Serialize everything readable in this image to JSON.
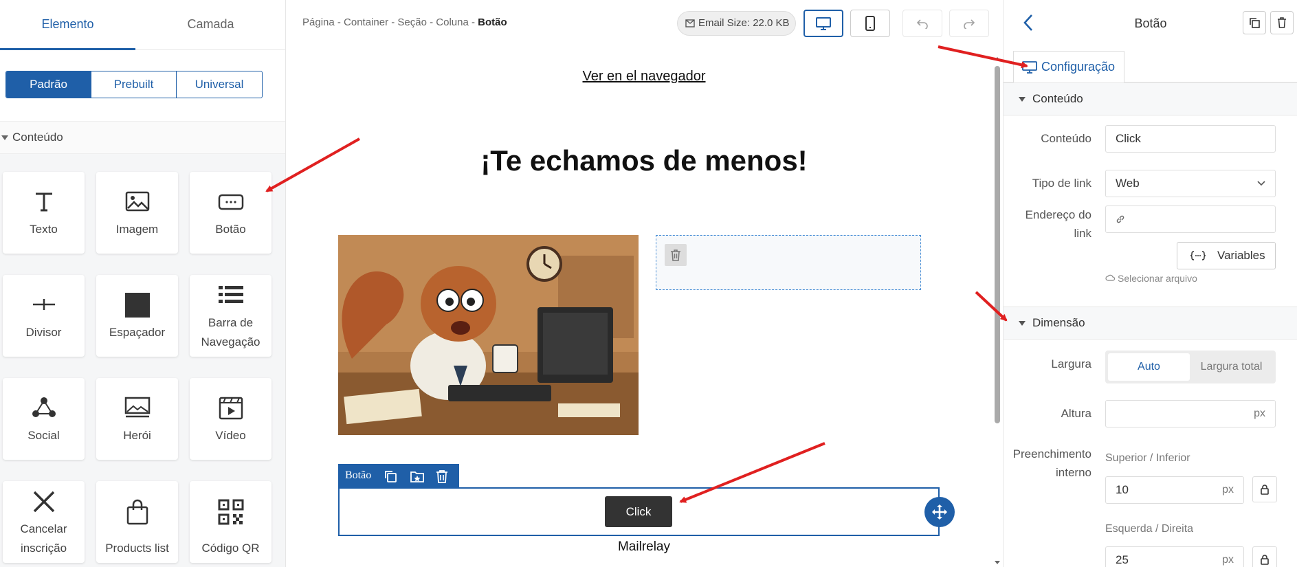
{
  "left_panel": {
    "tabs": [
      "Elemento",
      "Camada"
    ],
    "segments": [
      "Padrão",
      "Prebuilt",
      "Universal"
    ],
    "section": "Conteúdo",
    "tiles": [
      {
        "label": "Texto",
        "icon": "text-icon"
      },
      {
        "label": "Imagem",
        "icon": "image-icon"
      },
      {
        "label": "Botão",
        "icon": "button-icon"
      },
      {
        "label": "Divisor",
        "icon": "divider-icon"
      },
      {
        "label": "Espaçador",
        "icon": "spacer-icon"
      },
      {
        "label": "Barra de Navegação",
        "icon": "navbar-icon"
      },
      {
        "label": "Social",
        "icon": "social-icon"
      },
      {
        "label": "Herói",
        "icon": "hero-icon"
      },
      {
        "label": "Vídeo",
        "icon": "video-icon"
      },
      {
        "label": "Cancelar inscrição",
        "icon": "unsubscribe-icon"
      },
      {
        "label": "Products list",
        "icon": "shopping-bag-icon"
      },
      {
        "label": "Código QR",
        "icon": "qr-code-icon"
      }
    ]
  },
  "canvas": {
    "breadcrumb": {
      "path": "Página - Container - Seção - Coluna - ",
      "current": "Botão"
    },
    "email_size": "Email Size: 22.0 KB",
    "view_link": "Ver en el navegador",
    "heading": "¡Te echamos de menos!",
    "toolbar_label": "Botão",
    "button_text": "Click",
    "footer_text": "Mailrelay",
    "accent": "#1f5fa8"
  },
  "right_panel": {
    "title": "Botão",
    "tab": "Configuração",
    "content_section": "Conteúdo",
    "content_label": "Conteúdo",
    "content_value": "Click",
    "link_type_label": "Tipo de link",
    "link_type_value": "Web",
    "link_address_label_1": "Endereço do",
    "link_address_label_2": "link",
    "variables_button": "Variables",
    "select_file": "Selecionar arquivo",
    "dimension_section": "Dimensão",
    "width_label": "Largura",
    "width_options": [
      "Auto",
      "Largura total"
    ],
    "height_label": "Altura",
    "height_unit": "px",
    "padding_label_1": "Preenchimento",
    "padding_label_2": "interno",
    "top_bottom_label": "Superior / Inferior",
    "top_bottom_value": "10",
    "left_right_label": "Esquerda / Direita",
    "left_right_value": "25",
    "unit": "px"
  }
}
